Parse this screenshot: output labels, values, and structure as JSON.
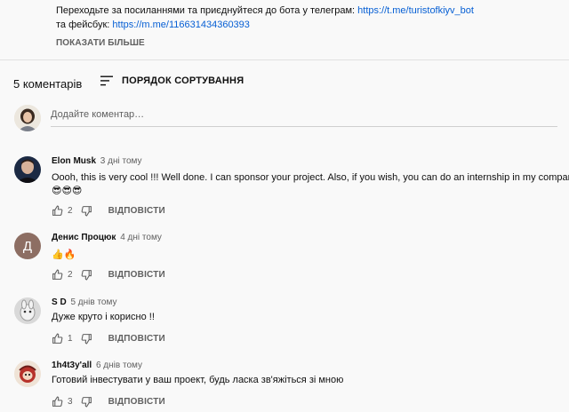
{
  "description": {
    "line1": "Переходьте за посиланнями та приєднуйтеся до бота у телеграм:",
    "telegram_link": "https://t.me/turistofkiyv_bot",
    "line2": "та фейсбук:",
    "facebook_link": "https://m.me/116631434360393",
    "show_more": "ПОКАЗАТИ БІЛЬШЕ"
  },
  "comments_header": {
    "count": "5 коментарів",
    "sort_label": "ПОРЯДОК СОРТУВАННЯ"
  },
  "add_comment": {
    "placeholder": "Додайте коментар…"
  },
  "reply_label": "ВІДПОВІСТИ",
  "comments": [
    {
      "author": "Elon Musk",
      "time": "3 дні тому",
      "text": "Oooh, this is very cool !!!  Well done.  I can sponsor your project.  Also, if you wish, you can do an internship in my company.",
      "text2": "😎😎😎",
      "likes": "2",
      "avatar": "photo-avatar"
    },
    {
      "author": "Денис Процюк",
      "time": "4 дні тому",
      "text": "👍🔥",
      "likes": "2",
      "avatar_letter": "Д",
      "avatar_color": "#8d6e63"
    },
    {
      "author": "S D",
      "time": "5 днів тому",
      "text": "Дуже круто і корисно !!",
      "likes": "1",
      "avatar": "cartoon-avatar"
    },
    {
      "author": "1h4t3y'all",
      "time": "6 днів тому",
      "text": "Готовий інвестувати у ваш проект, будь ласка зв'яжіться зі мною",
      "likes": "3",
      "avatar": "character-avatar"
    }
  ],
  "colors": {
    "link": "#065fd4",
    "secondary_text": "#606060",
    "background": "#f9f9f9"
  }
}
